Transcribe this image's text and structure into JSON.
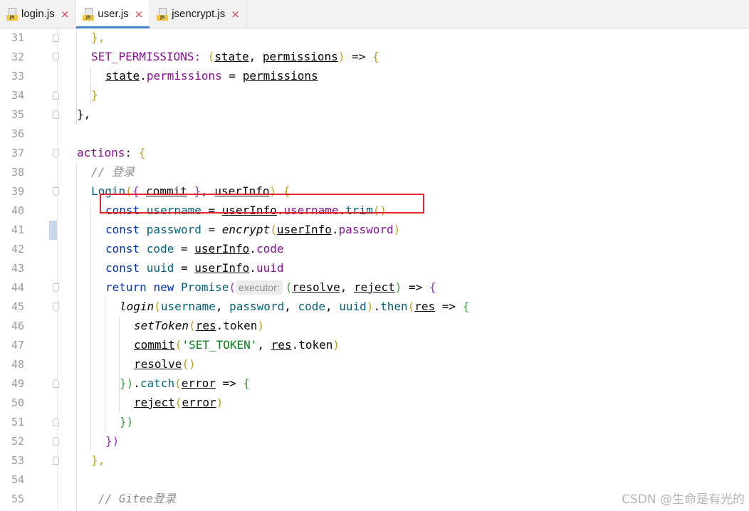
{
  "tabs": [
    {
      "label": "login.js",
      "icon": "js-file-icon",
      "badge": "JS",
      "active": false
    },
    {
      "label": "user.js",
      "icon": "js-file-icon",
      "badge": "JS",
      "active": true
    },
    {
      "label": "jsencrypt.js",
      "icon": "js-file-icon",
      "badge": "JS",
      "active": false
    }
  ],
  "close_glyph": "×",
  "line_numbers": [
    "31",
    "32",
    "33",
    "34",
    "35",
    "36",
    "37",
    "38",
    "39",
    "40",
    "41",
    "42",
    "43",
    "44",
    "45",
    "46",
    "47",
    "48",
    "49",
    "50",
    "51",
    "52",
    "53",
    "54",
    "55"
  ],
  "code": {
    "l31": {
      "a": "},"
    },
    "l32": {
      "a": "SET_PERMISSIONS: ",
      "b": "(",
      "c": "state",
      "d": ", ",
      "e": "permissions",
      "f": ")",
      "g": " => ",
      "h": "{"
    },
    "l33": {
      "a": "state",
      "b": ".",
      "c": "permissions",
      "d": " = ",
      "e": "permissions"
    },
    "l34": {
      "a": "}"
    },
    "l35": {
      "a": "},"
    },
    "l37": {
      "a": "actions",
      "b": ": ",
      "c": "{"
    },
    "l38": {
      "a": "// 登录"
    },
    "l39": {
      "a": "Login",
      "b": "(",
      "c": "{ ",
      "d": "commit",
      "e": " }",
      "f": ", ",
      "g": "userInfo",
      "h": ")",
      "i": " ",
      "j": "{"
    },
    "l40": {
      "a": "const ",
      "b": "username",
      "c": " = ",
      "d": "userInfo",
      "e": ".",
      "f": "username",
      "g": ".",
      "h": "trim",
      "i": "()"
    },
    "l41": {
      "a": "const ",
      "b": "password",
      "c": " = ",
      "d": "encrypt",
      "e": "(",
      "f": "userInfo",
      "g": ".",
      "h": "password",
      "i": ")"
    },
    "l42": {
      "a": "const ",
      "b": "code",
      "c": " = ",
      "d": "userInfo",
      "e": ".",
      "f": "code"
    },
    "l43": {
      "a": "const ",
      "b": "uuid",
      "c": " = ",
      "d": "userInfo",
      "e": ".",
      "f": "uuid"
    },
    "l44": {
      "a": "return ",
      "b": "new ",
      "c": "Promise",
      "d": "(",
      "hint": "executor:",
      "e": "(",
      "f": "resolve",
      "g": ", ",
      "h": "reject",
      "i": ")",
      "j": " => ",
      "k": "{"
    },
    "l45": {
      "a": "login",
      "b": "(",
      "c": "username",
      "d": ", ",
      "e": "password",
      "f": ", ",
      "g": "code",
      "h": ", ",
      "i": "uuid",
      "j": ")",
      "k": ".",
      "l": "then",
      "m": "(",
      "n": "res",
      "o": " => ",
      "p": "{"
    },
    "l46": {
      "a": "setToken",
      "b": "(",
      "c": "res",
      "d": ".",
      "e": "token",
      "f": ")"
    },
    "l47": {
      "a": "commit",
      "b": "(",
      "c": "'SET_TOKEN'",
      "d": ", ",
      "e": "res",
      "f": ".",
      "g": "token",
      "h": ")"
    },
    "l48": {
      "a": "resolve",
      "b": "()"
    },
    "l49": {
      "a": "})",
      "b": ".",
      "c": "catch",
      "d": "(",
      "e": "error",
      "f": " => ",
      "g": "{"
    },
    "l50": {
      "a": "reject",
      "b": "(",
      "c": "error",
      "d": ")"
    },
    "l51": {
      "a": "})"
    },
    "l52": {
      "a": "})"
    },
    "l53": {
      "a": "},"
    },
    "l55": {
      "a": "// Gitee",
      "b": "登录"
    }
  },
  "watermark": "CSDN @生命是有光的",
  "colors": {
    "keyword": "#0033b3",
    "function": "#00627a",
    "property": "#871094",
    "string": "#067d17",
    "comment": "#8c8c8c",
    "highlight_box": "#e0262b",
    "active_tab": "#4083c9"
  }
}
